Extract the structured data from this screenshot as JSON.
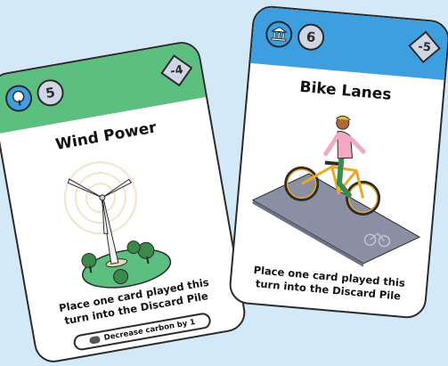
{
  "background_color": "#d3e9f8",
  "cards": [
    {
      "title": "Wind Power",
      "cost": "5",
      "impact": "-4",
      "description_line1": "Place one card played this",
      "description_line2": "turn into the Discard Pile",
      "effect": "Decrease carbon by 1",
      "header_color": "#5cbf7f",
      "icon": "tree-icon"
    },
    {
      "title": "Bike Lanes",
      "cost": "6",
      "impact": "-5",
      "description_line1": "Place one card played this",
      "description_line2": "turn into the Discard Pile",
      "header_color": "#3d9ee0",
      "icon": "government-building-icon"
    }
  ]
}
